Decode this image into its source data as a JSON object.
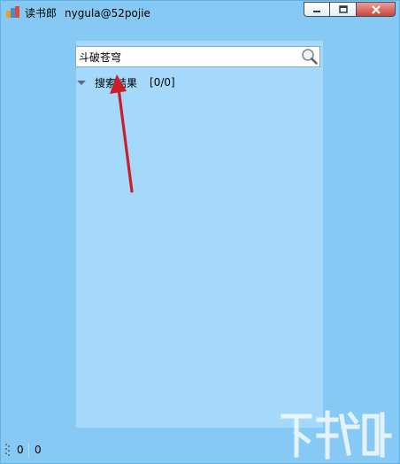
{
  "window": {
    "app_name": "读书郎",
    "user": "nygula@52pojie",
    "controls": {
      "minimize_icon": "minimize-icon",
      "maximize_icon": "maximize-icon",
      "close_icon": "close-icon"
    }
  },
  "search": {
    "value": "斗破苍穹",
    "button_icon": "magnifier-icon"
  },
  "results": {
    "label": "搜索结果",
    "count": "[0/0]",
    "toggle_icon": "collapse-triangle-icon"
  },
  "statusbar": {
    "value_1": "0",
    "value_2": "0"
  },
  "colors": {
    "window_bg": "#86c9f5",
    "panel_bg": "#a5d9fc",
    "close_button": "#c7463b",
    "annotation_arrow": "#c8202a"
  }
}
